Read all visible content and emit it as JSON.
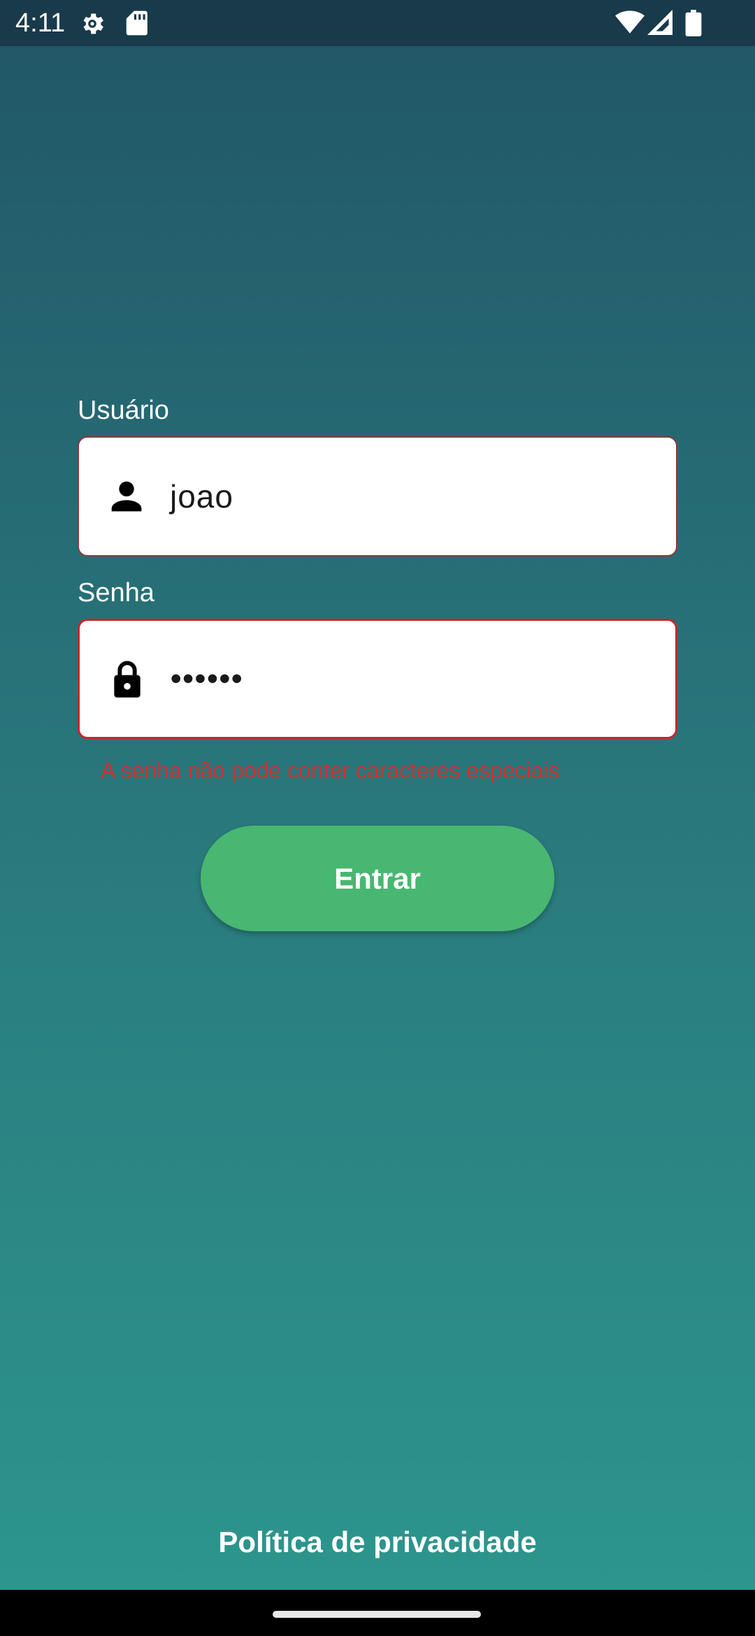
{
  "status_bar": {
    "time": "4:11",
    "icons": [
      "settings-icon",
      "sd-card-icon",
      "wifi-icon",
      "signal-icon",
      "battery-icon"
    ]
  },
  "form": {
    "username_label": "Usuário",
    "username_value": "joao",
    "password_label": "Senha",
    "password_value": "••••••",
    "password_error": "A senha não pode conter caracteres especiais",
    "submit_label": "Entrar"
  },
  "footer": {
    "privacy_link": "Política de privacidade"
  },
  "colors": {
    "background_top": "#215667",
    "background_bottom": "#2d978d",
    "button": "#48b771",
    "error": "#d32f2f"
  }
}
